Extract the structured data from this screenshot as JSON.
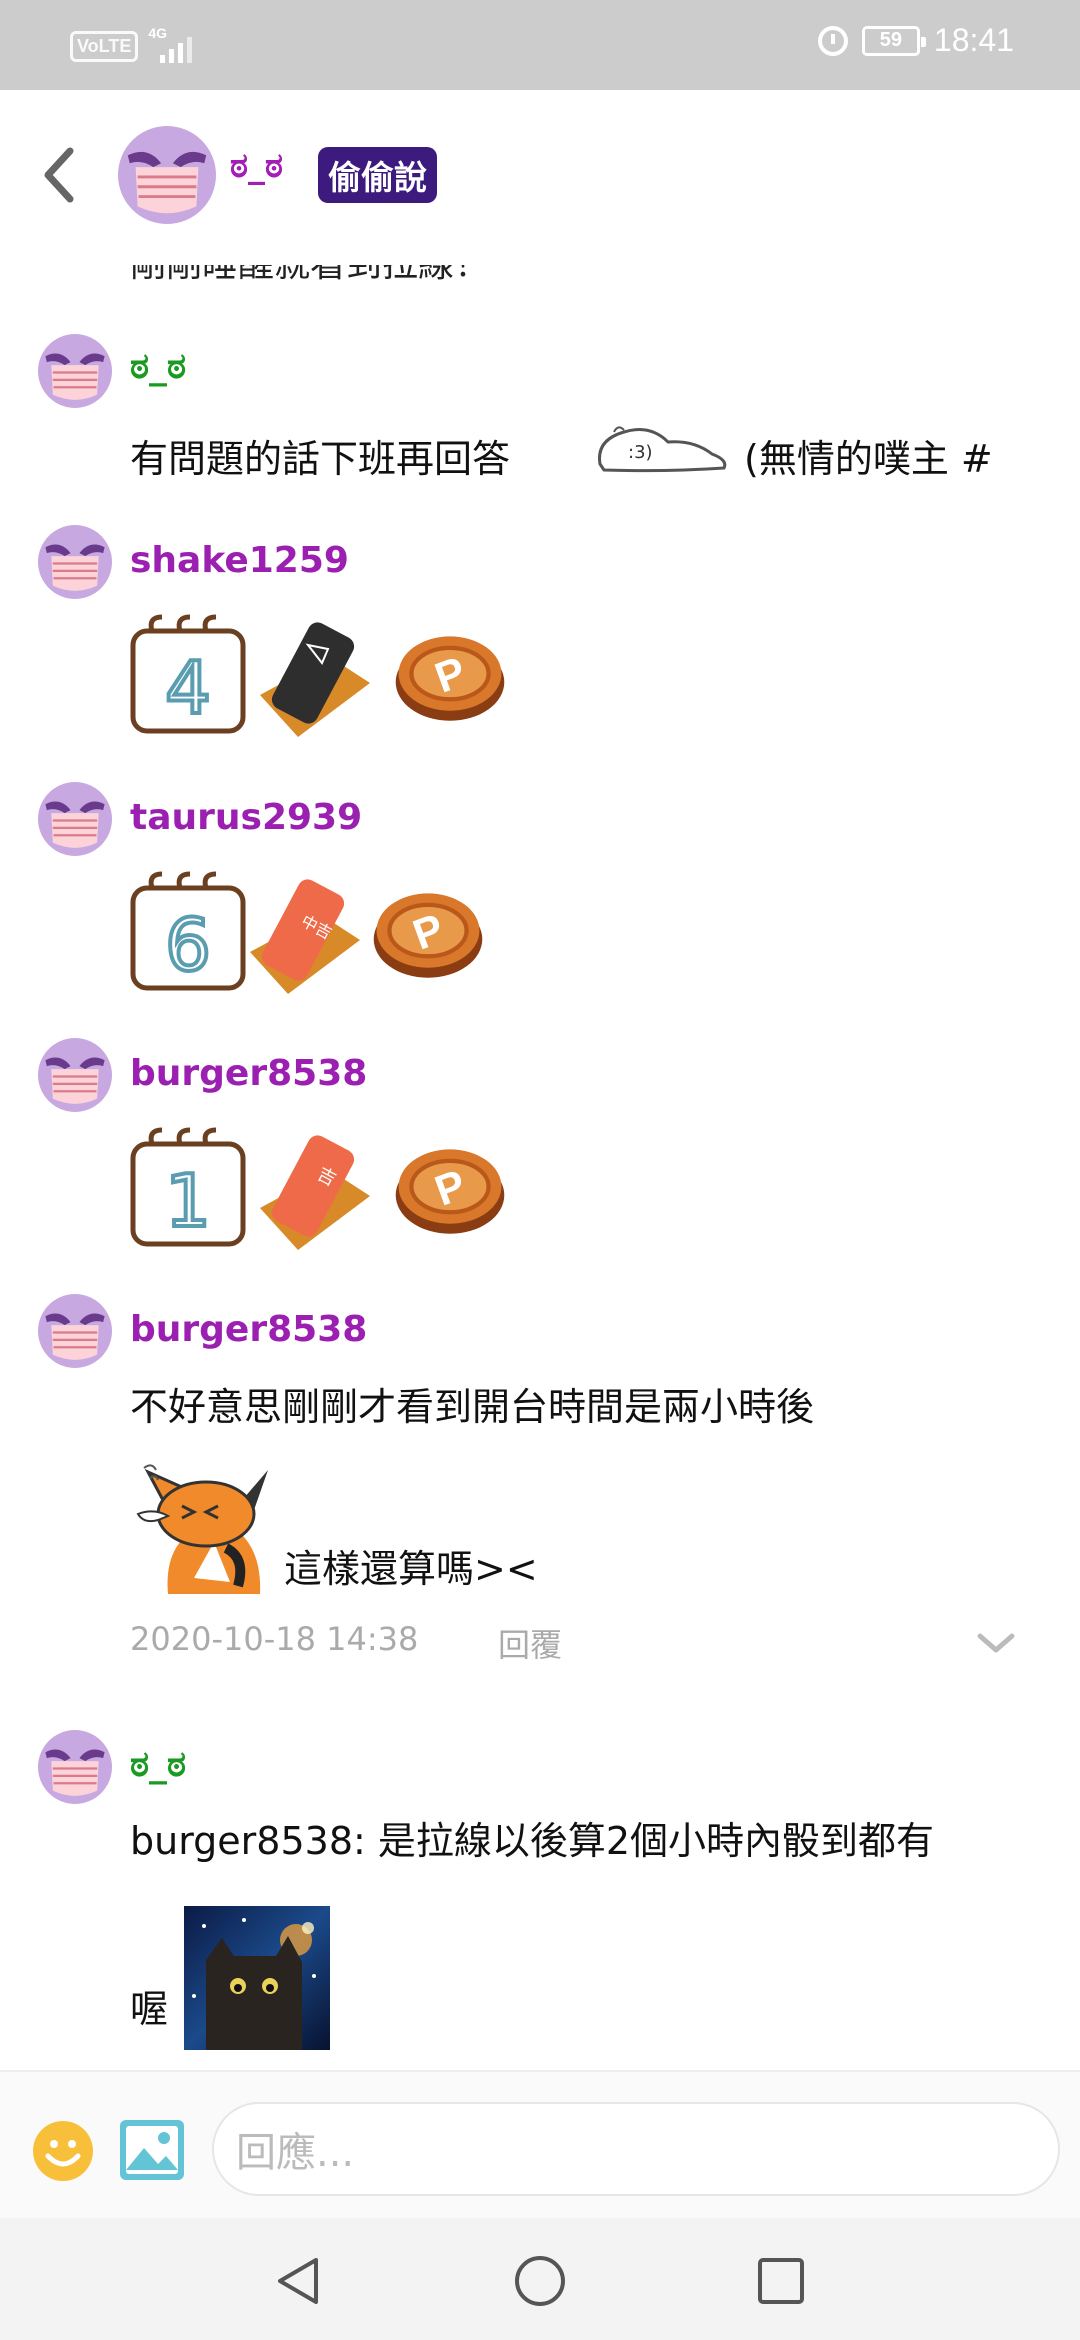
{
  "status_bar": {
    "network": "VoLTE",
    "signal_type": "4G",
    "battery": "59",
    "time": "18:41"
  },
  "header": {
    "name": "ಠ_ಠ",
    "badge": "偷偷說"
  },
  "clipped_previous_text": "剛剛睡醒就看到拉線！",
  "messages": [
    {
      "name": "ಠ_ಠ",
      "text": "有問題的話下班再回答",
      "text_after_sticker": "(無情的噗主 #"
    },
    {
      "name": "shake1259",
      "dice_number": "4"
    },
    {
      "name": "taurus2939",
      "dice_number": "6",
      "fortune_stick": "中吉"
    },
    {
      "name": "burger8538",
      "dice_number": "1",
      "fortune_stick": "吉"
    },
    {
      "name": "burger8538",
      "text": "不好意思剛剛才看到開台時間是兩小時後",
      "text2": "這樣還算嗎><"
    },
    {
      "name": "ಠ_ಠ",
      "text": "burger8538: 是拉線以後算2個小時內骰到都有",
      "text2": "喔"
    }
  ],
  "meta": {
    "timestamp": "2020-10-18 14:38",
    "reply_label": "回覆"
  },
  "input": {
    "placeholder": "回應..."
  },
  "colors": {
    "status_bar": "#cccccc",
    "name_green": "#1a9a20",
    "name_purple": "#9b1fb0",
    "badge_bg": "#3c1a7e",
    "emoji_yellow": "#f8c03a",
    "image_icon": "#63c4d6"
  }
}
